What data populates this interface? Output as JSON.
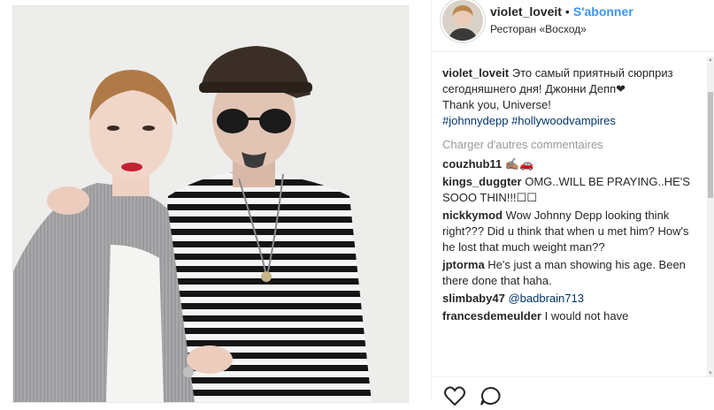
{
  "post": {
    "username": "violet_loveit",
    "follow_label": "S'abonner",
    "separator": "•",
    "location": "Ресторан «Восход»"
  },
  "caption": {
    "username": "violet_loveit",
    "text": "Это самый приятный сюрприз сегодняшнего дня! Джонни Депп❤",
    "line2": "Thank you, Universe!",
    "hashtags": "#johnnydepp #hollywoodvampires"
  },
  "load_more": "Charger d'autres commentaires",
  "comments": [
    {
      "user": "couzhub11",
      "text": "✍🏽🚗"
    },
    {
      "user": "kings_duggter",
      "text": "OMG..WILL BE PRAYING..HE'S SOOO THIN!!!☐☐"
    },
    {
      "user": "nickkymod",
      "text": "Wow Johnny Depp looking think right??? Did u think that when u met him? How's he lost that much weight man??"
    },
    {
      "user": "jptorma",
      "text": "He's just a man showing his age. Been there done that haha."
    },
    {
      "user": "slimbaby47",
      "text": "@badbrain713"
    },
    {
      "user": "francesdemeulder",
      "text": "I would not have"
    }
  ],
  "icons": [
    "heart-icon",
    "comment-icon"
  ],
  "colors": {
    "accent": "#3897f0",
    "hashtag": "#003569",
    "muted": "#999999",
    "text": "#262626"
  }
}
